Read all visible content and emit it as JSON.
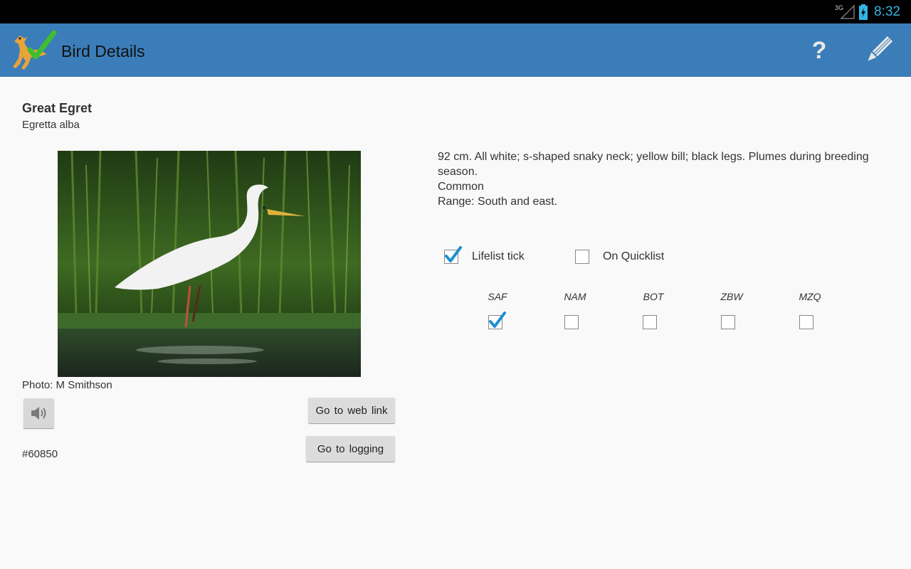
{
  "status_bar": {
    "time": "8:32",
    "network_label": "3G",
    "signal_icon": "signal-icon",
    "battery_icon": "battery-charging-icon"
  },
  "action_bar": {
    "title": "Bird Details",
    "app_icon": "bird-check-icon",
    "help_icon": "help-icon",
    "edit_icon": "pencil-icon",
    "color": "#3b7db8"
  },
  "bird": {
    "common_name": "Great Egret",
    "scientific_name": "Egretta alba",
    "photo_credit": "Photo: M Smithson",
    "id": "#60850",
    "description_line1": "92 cm. All white; s-shaped snaky neck; yellow bill; black legs.  Plumes during breeding season.",
    "description_line2": "Common",
    "description_line3": "Range: South and east."
  },
  "buttons": {
    "web_link": "Go to web link",
    "logging": "Go  to  logging",
    "sound_icon": "speaker-icon"
  },
  "checks": {
    "lifelist": {
      "label": "Lifelist tick",
      "checked": true
    },
    "quicklist": {
      "label": "On Quicklist",
      "checked": false
    }
  },
  "regions": [
    {
      "label": "SAF",
      "checked": true
    },
    {
      "label": "NAM",
      "checked": false
    },
    {
      "label": "BOT",
      "checked": false
    },
    {
      "label": "ZBW",
      "checked": false
    },
    {
      "label": "MZQ",
      "checked": false
    }
  ],
  "colors": {
    "accent": "#33b5e5",
    "check": "#1a8fd0"
  }
}
